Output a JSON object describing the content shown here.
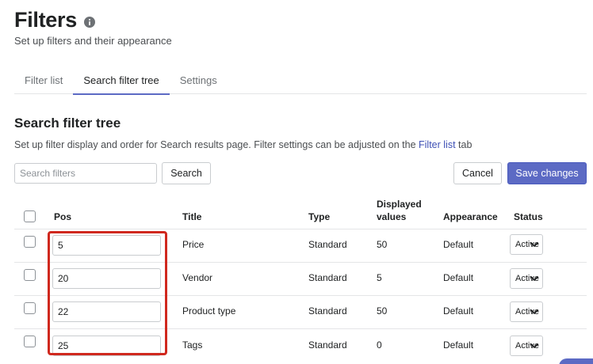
{
  "header": {
    "title": "Filters",
    "subtitle": "Set up filters and their appearance",
    "info_icon": "info-circle-icon"
  },
  "tabs": [
    {
      "label": "Filter list",
      "active": false
    },
    {
      "label": "Search filter tree",
      "active": true
    },
    {
      "label": "Settings",
      "active": false
    }
  ],
  "section": {
    "title": "Search filter tree",
    "desc_prefix": "Set up filter display and order for Search results page. Filter settings can be adjusted on the ",
    "desc_link": "Filter list",
    "desc_suffix": " tab"
  },
  "toolbar": {
    "search_placeholder": "Search filters",
    "search_button": "Search",
    "cancel_button": "Cancel",
    "save_button": "Save changes"
  },
  "table": {
    "columns": {
      "pos": "Pos",
      "title": "Title",
      "type": "Type",
      "displayed_line1": "Displayed",
      "displayed_line2": "values",
      "appearance": "Appearance",
      "status": "Status"
    },
    "rows": [
      {
        "pos": "5",
        "title": "Price",
        "type": "Standard",
        "displayed": "50",
        "appearance": "Default",
        "status": "Active"
      },
      {
        "pos": "20",
        "title": "Vendor",
        "type": "Standard",
        "displayed": "5",
        "appearance": "Default",
        "status": "Active"
      },
      {
        "pos": "22",
        "title": "Product type",
        "type": "Standard",
        "displayed": "50",
        "appearance": "Default",
        "status": "Active"
      },
      {
        "pos": "25",
        "title": "Tags",
        "type": "Standard",
        "displayed": "0",
        "appearance": "Default",
        "status": "Active"
      }
    ]
  },
  "colors": {
    "accent": "#5c6ac4",
    "highlight": "#d0281e",
    "link": "#3f51b5"
  }
}
